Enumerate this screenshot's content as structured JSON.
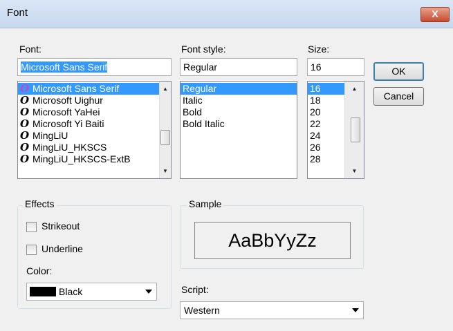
{
  "window": {
    "title": "Font",
    "close_label": "X"
  },
  "font": {
    "label": "Font:",
    "value": "Microsoft Sans Serif",
    "items": [
      {
        "label": "Microsoft Sans Serif",
        "icon": "O",
        "selected": true
      },
      {
        "label": "Microsoft Uighur",
        "icon": "O"
      },
      {
        "label": "Microsoft YaHei",
        "icon": "O"
      },
      {
        "label": "Microsoft Yi Baiti",
        "icon": "O"
      },
      {
        "label": "MingLiU",
        "icon": "O"
      },
      {
        "label": "MingLiU_HKSCS",
        "icon": "O"
      },
      {
        "label": "MingLiU_HKSCS-ExtB",
        "icon": "O"
      }
    ]
  },
  "font_style": {
    "label": "Font style:",
    "value": "Regular",
    "items": [
      {
        "label": "Regular",
        "selected": true
      },
      {
        "label": "Italic"
      },
      {
        "label": "Bold"
      },
      {
        "label": "Bold Italic"
      }
    ]
  },
  "size": {
    "label": "Size:",
    "value": "16",
    "items": [
      {
        "label": "16",
        "selected": true
      },
      {
        "label": "18"
      },
      {
        "label": "20"
      },
      {
        "label": "22"
      },
      {
        "label": "24"
      },
      {
        "label": "26"
      },
      {
        "label": "28"
      }
    ]
  },
  "buttons": {
    "ok": "OK",
    "cancel": "Cancel"
  },
  "effects": {
    "label": "Effects",
    "strikeout": "Strikeout",
    "underline": "Underline",
    "strikeout_checked": false,
    "underline_checked": false
  },
  "color": {
    "label": "Color:",
    "value": "Black",
    "swatch": "#000000"
  },
  "sample": {
    "label": "Sample",
    "text": "AaBbYyZz"
  },
  "script": {
    "label": "Script:",
    "value": "Western"
  },
  "icons": {
    "font_type": "opentype-font-icon",
    "scroll_up": "scroll-up-arrow-icon",
    "scroll_down": "scroll-down-arrow-icon",
    "dropdown": "dropdown-arrow-icon"
  }
}
